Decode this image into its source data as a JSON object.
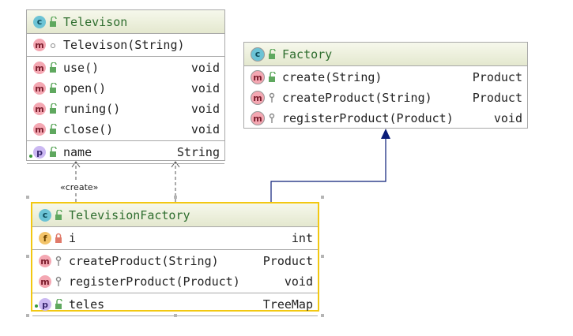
{
  "classes": {
    "televison": {
      "name": "Televison",
      "constructor": {
        "sig": "Televison(String)"
      },
      "methods": [
        {
          "sig": "use()",
          "type": "void"
        },
        {
          "sig": "open()",
          "type": "void"
        },
        {
          "sig": "runing()",
          "type": "void"
        },
        {
          "sig": "close()",
          "type": "void"
        }
      ],
      "fields": [
        {
          "sig": "name",
          "type": "String"
        }
      ]
    },
    "factory": {
      "name": "Factory",
      "methods": [
        {
          "sig": "create(String)",
          "type": "Product"
        },
        {
          "sig": "createProduct(String)",
          "type": "Product"
        },
        {
          "sig": "registerProduct(Product)",
          "type": "void"
        }
      ]
    },
    "televisionFactory": {
      "name": "TelevisionFactory",
      "fields": [
        {
          "sig": "i",
          "type": "int"
        }
      ],
      "methods": [
        {
          "sig": "createProduct(String)",
          "type": "Product"
        },
        {
          "sig": "registerProduct(Product)",
          "type": "void"
        }
      ],
      "properties": [
        {
          "sig": "teles",
          "type": "TreeMap"
        }
      ]
    }
  },
  "relations": {
    "create_label": "«create»"
  },
  "badges": {
    "class": "c",
    "method": "m",
    "property": "p",
    "field": "f"
  },
  "colors": {
    "header_text": "#2f6e2f",
    "header_bg": "#e4e8cf",
    "selected_border": "#f2c811",
    "inheritance_arrow": "#0b1d78"
  }
}
